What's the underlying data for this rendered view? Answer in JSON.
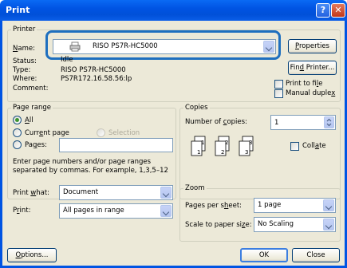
{
  "window": {
    "title": "Print",
    "help_glyph": "?",
    "close_glyph": "✕"
  },
  "printer": {
    "legend": "Printer",
    "name_label": "Name:",
    "name_value": "RISO PS7R-HC5000",
    "status_label": "Status:",
    "status_value": "Idle",
    "type_label": "Type:",
    "type_value": "RISO PS7R-HC5000",
    "where_label": "Where:",
    "where_value": "PS7R172.16.58.56:lp",
    "comment_label": "Comment:",
    "properties_label": "Properties",
    "find_printer_label": "Find Printer...",
    "print_to_file_label": "Print to file",
    "manual_duplex_label": "Manual duplex"
  },
  "page_range": {
    "legend": "Page range",
    "all_label": "All",
    "current_page_label": "Current page",
    "selection_label": "Selection",
    "pages_label": "Pages:",
    "pages_value": "",
    "help_text_1": "Enter page numbers and/or page ranges",
    "help_text_2": "separated by commas.  For example, 1,3,5–12"
  },
  "copies": {
    "legend": "Copies",
    "number_label": "Number of copies:",
    "number_value": "1",
    "collate_label": "Collate",
    "collate_checked": false
  },
  "print_what": {
    "label": "Print what:",
    "value": "Document"
  },
  "print": {
    "label": "Print:",
    "value": "All pages in range"
  },
  "zoom": {
    "legend": "Zoom",
    "pages_per_sheet_label": "Pages per sheet:",
    "pages_per_sheet_value": "1 page",
    "scale_label": "Scale to paper size:",
    "scale_value": "No Scaling"
  },
  "footer": {
    "options_label": "Options...",
    "ok_label": "OK",
    "close_label": "Close"
  },
  "colors": {
    "title_bar": "#0054e3",
    "dialog_bg": "#ece9d8",
    "highlight": "#1e6fbf"
  }
}
